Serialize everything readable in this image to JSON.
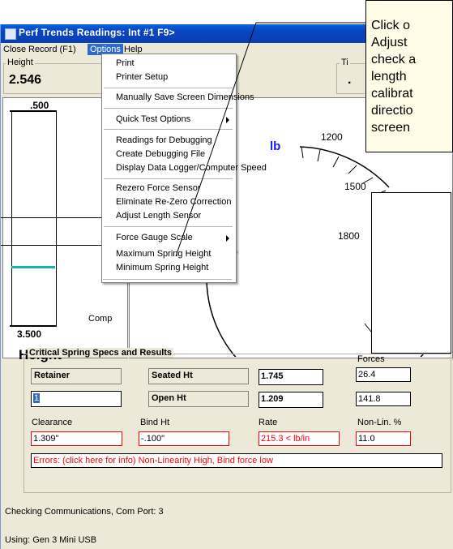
{
  "window": {
    "title": "Perf Trends Readings: Int #1    F9>"
  },
  "menubar": {
    "items": [
      "Close",
      "Record (F1)",
      "Options",
      "Help"
    ],
    "active": "Options"
  },
  "height_panel": {
    "label": "Height",
    "value": "2.546"
  },
  "gauge_panel": {
    "top_label": ".500",
    "bottom_label": "3.500",
    "caption": "Height",
    "comp_label": "Comp"
  },
  "dial": {
    "unit": "lb",
    "ticks": [
      "1200",
      "1500",
      "1800"
    ]
  },
  "right_partial": {
    "label": "Ti",
    "value": "."
  },
  "options_menu": {
    "groups": [
      [
        "Print",
        "Printer Setup"
      ],
      [
        "Manually Save Screen Dimensions"
      ],
      [
        "Quick Test Options"
      ],
      [
        "Readings for Debugging",
        "Create Debugging File",
        "Display Data Logger/Computer Speed"
      ],
      [
        "Rezero Force Sensor",
        "Eliminate Re-Zero Correction",
        "Adjust Length Sensor"
      ],
      [
        "Force Gauge Scale",
        "Maximum Spring Height",
        "Minimum Spring Height"
      ]
    ]
  },
  "specs": {
    "title": "Critical Spring Specs and Results",
    "retainer_label": "Retainer",
    "retainer_value": "1",
    "seated_label": "Seated Ht",
    "seated_value": "1.745",
    "open_label": "Open Ht",
    "open_value": "1.209",
    "forces_label": "Forces",
    "force1": "26.4",
    "force2": "141.8",
    "clearance_label": "Clearance",
    "clearance_value": "1.309\"",
    "bind_label": "Bind Ht",
    "bind_value": "-.100\"",
    "rate_label": "Rate",
    "rate_value": "215.3 < lb/in",
    "nonlin_label": "Non-Lin. %",
    "nonlin_value": "11.0",
    "errors": "Errors: (click here for info) Non-Linearity High, Bind force low"
  },
  "status": {
    "comm": "Checking Communications, Com Port:  3",
    "device": "Using: Gen 3 Mini USB"
  },
  "callout": {
    "lines": [
      "Click o",
      "Adjust",
      "check a",
      "length",
      "calibrat",
      "directio",
      "screen"
    ]
  },
  "colors": {
    "titlebar": "#0845c1",
    "menu_highlight": "#316ac5",
    "error_text": "#ff0000",
    "gauge_fill": "#17b3b3",
    "dial_unit": "#1a1aff"
  }
}
